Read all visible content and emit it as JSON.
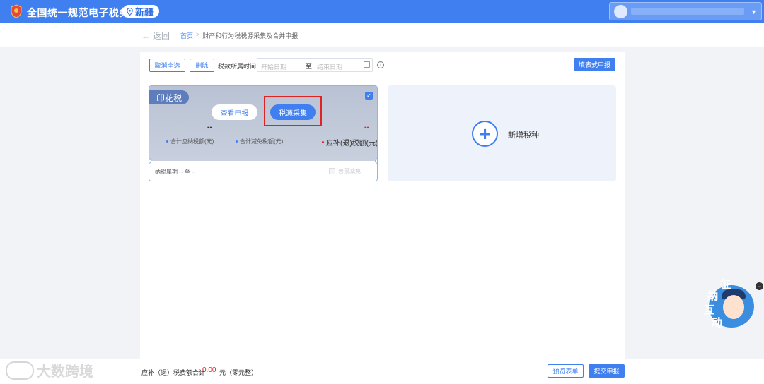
{
  "header": {
    "site_title": "全国统一规范电子税务局",
    "region": "新疆"
  },
  "breadcrumb": {
    "back_label": "返回",
    "home": "首页",
    "separator": ">",
    "current": "财产和行为税税源采集及合并申报"
  },
  "toolbar": {
    "cancel_select_all": "取消全选",
    "delete": "删除",
    "period_label": "税款所属时间",
    "start_date_placeholder": "开始日期",
    "range_separator": "至",
    "end_date_placeholder": "结束日期",
    "form_filing": "填表式申报"
  },
  "tax_card": {
    "tag": "印花税",
    "checked": true,
    "view_button": "查看申报",
    "collect_button": "税源采集",
    "payable_value": "--",
    "refund_value": "--",
    "payable_label": "合计应纳税额(元)",
    "reduction_label": "合计减免税额(元)",
    "refund_label": "应补(退)税额(元)",
    "period_text": "纳税属期 -- 至 --",
    "invoice_reduction": "普票减免"
  },
  "add_card": {
    "label": "新增税种"
  },
  "footer": {
    "total_label": "应补（退）税费额合计",
    "total_amount": "0.00",
    "total_unit": "元（零元整）",
    "preview_button": "预览表单",
    "submit_button": "提交申报",
    "watermark": "大数跨境"
  },
  "mascot": {
    "chars": [
      "征",
      "纳",
      "互",
      "动"
    ]
  },
  "colors": {
    "primary": "#3f7ff0",
    "alert_red": "#e02222",
    "page_bg": "#f2f3f6"
  }
}
